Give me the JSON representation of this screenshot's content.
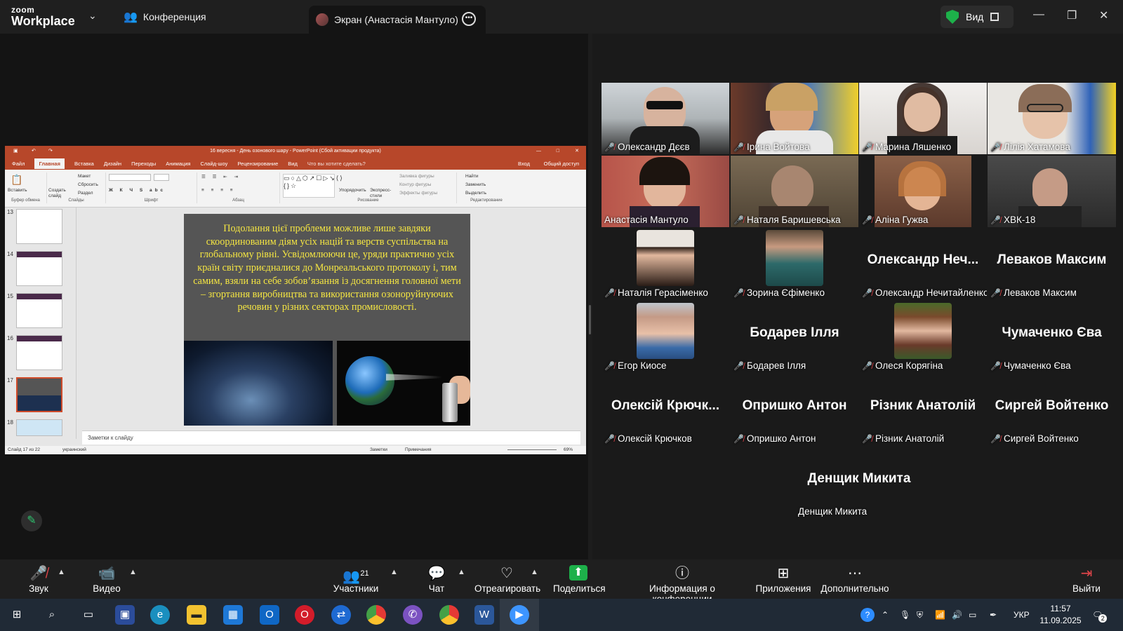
{
  "app": {
    "logo_top": "zoom",
    "logo_bottom": "Workplace",
    "conference_tab": "Конференция",
    "screen_tab": "Экран (Анастасія Мантуло)",
    "view_label": "Вид"
  },
  "ppt": {
    "window_title": "16 вересня - День озонового шару - PowerPoint (Сбой активации продукта)",
    "menu": [
      "Файл",
      "Главная",
      "Вставка",
      "Дизайн",
      "Переходы",
      "Анимация",
      "Слайд-шоу",
      "Рецензирование",
      "Вид",
      "Что вы хотите сделать?"
    ],
    "menu_right": [
      "Вход",
      "Общий доступ"
    ],
    "ribbon": {
      "paste": "Вставить",
      "clipboard": "Буфер обмена",
      "create_slide": "Создать слайд",
      "layout": "Макет",
      "reset": "Сбросить",
      "section": "Раздел",
      "slides": "Слайды",
      "font": "Шрифт",
      "paragraph": "Абзац",
      "arrange": "Упорядочить",
      "express_styles": "Экспресс-стили",
      "fill": "Заливка фигуры",
      "outline": "Контур фигуры",
      "effects": "Эффекты фигуры",
      "drawing": "Рисование",
      "find": "Найти",
      "replace": "Заменить",
      "select": "Выделить",
      "editing": "Редактирование"
    },
    "thumbnails": [
      "13",
      "14",
      "15",
      "16",
      "17",
      "18"
    ],
    "slide_text": "Подолання цієї проблеми можливе лише завдяки скоординованим діям усіх націй та верств суспільства на глобальному рівні. Усвідомлюючи це, уряди практично усіх країн світу приєдналися до Монреальського протоколу і, тим самим, взяли на себе зобов’язання із досягнення головної мети – згортання виробництва та використання озоноруйнуючих речовин у різних секторах промисловості.",
    "notes_placeholder": "Заметки к слайду",
    "status_left": "Слайд 17 из 22",
    "status_lang": "украинский",
    "status_notes": "Заметки",
    "status_comments": "Примечания",
    "zoom": "69%"
  },
  "participants": [
    {
      "name": "Олександр Дєєв",
      "video": true
    },
    {
      "name": "Ірина Войтова",
      "video": true
    },
    {
      "name": "Марина Ляшенко",
      "video": true
    },
    {
      "name": "Лілія Хатамова",
      "video": true
    },
    {
      "name": "Анастасія Мантуло",
      "video": true,
      "active": true
    },
    {
      "name": "Наталя Баришевська",
      "video": true
    },
    {
      "name": "Аліна Гужва",
      "video": true
    },
    {
      "name": "ХВК-18",
      "video": true
    },
    {
      "name": "Наталія Герасіменко",
      "photo": true
    },
    {
      "name": "Зорина  Єфіменко",
      "photo": true
    },
    {
      "name": "Олександр Нечитайленко",
      "big": "Олександр  Неч..."
    },
    {
      "name": "Леваков Максим",
      "big": "Леваков Максим"
    },
    {
      "name": "Егор Киосе",
      "photo": true
    },
    {
      "name": "Бодарев Ілля",
      "big": "Бодарев Ілля"
    },
    {
      "name": "Олеся Корягіна",
      "photo": true
    },
    {
      "name": "Чумаченко Єва",
      "big": "Чумаченко Єва"
    },
    {
      "name": "Олексій Крючков",
      "big": "Олексій  Крючк..."
    },
    {
      "name": "Опришко Антон",
      "big": "Опришко Антон"
    },
    {
      "name": "Різник Анатолій",
      "big": "Різник Анатолій"
    },
    {
      "name": "Сиргей Войтенко",
      "big": "Сиргей Войтенко"
    },
    {
      "name": "Денщик Микита",
      "big": "Денщик Микита"
    }
  ],
  "toolbar": {
    "audio": "Звук",
    "video": "Видео",
    "participants": "Участники",
    "participants_count": "21",
    "chat": "Чат",
    "react": "Отреагировать",
    "share": "Поделиться",
    "info": "Информация о конференции",
    "apps": "Приложения",
    "more": "Дополнительно",
    "leave": "Выйти"
  },
  "taskbar": {
    "lang": "УКР",
    "time": "11:57",
    "date": "11.09.2025",
    "notifications": "2"
  }
}
